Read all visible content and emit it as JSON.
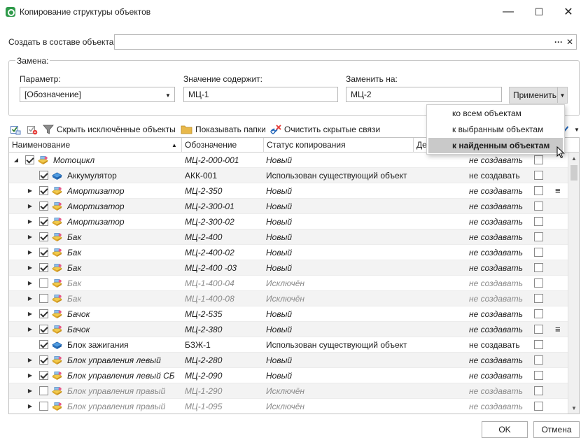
{
  "window": {
    "title": "Копирование структуры объектов",
    "minimize": "—",
    "maximize": "☐",
    "close": "✕"
  },
  "create": {
    "label": "Создать в составе объекта:",
    "value": "",
    "more": "···",
    "clear": "✕"
  },
  "replace": {
    "group_title": "Замена:",
    "param_label": "Параметр:",
    "param_value": "[Обозначение]",
    "contains_label": "Значение содержит:",
    "contains_value": "МЦ-1",
    "replace_label": "Заменить на:",
    "replace_value": "МЦ-2",
    "apply_label": "Применить"
  },
  "apply_menu": {
    "items": [
      {
        "label": "ко всем объектам"
      },
      {
        "label": "к выбранным объектам"
      },
      {
        "label": "к найденным объектам"
      }
    ],
    "highlighted_index": 2
  },
  "toolbar": {
    "hide_excluded": "Скрыть исключённые объекты",
    "show_folders": "Показывать папки",
    "clear_hidden_links": "Очистить скрытые связи"
  },
  "table": {
    "headers": {
      "name": "Наименование",
      "designation": "Обозначение",
      "status": "Статус копирования",
      "action": "Де"
    },
    "rows": [
      {
        "level": 0,
        "expand": "open",
        "checked": true,
        "italic": true,
        "grey": false,
        "icon": "assembly-icon",
        "name": "Мотоцикл",
        "designation": "МЦ-2-000-001",
        "status": "Новый",
        "action": "не создавать",
        "flag": false
      },
      {
        "level": 1,
        "expand": "none",
        "checked": true,
        "italic": false,
        "grey": false,
        "icon": "part-icon",
        "name": "Аккумулятор",
        "designation": "АКК-001",
        "status": "Использован существующий объект",
        "action": "не создавать",
        "flag": false
      },
      {
        "level": 1,
        "expand": "closed",
        "checked": true,
        "italic": true,
        "grey": false,
        "icon": "assembly-icon",
        "name": "Амортизатор",
        "designation": "МЦ-2-350",
        "status": "Новый",
        "action": "не создавать",
        "flag": true
      },
      {
        "level": 1,
        "expand": "closed",
        "checked": true,
        "italic": true,
        "grey": false,
        "icon": "assembly-icon",
        "name": "Амортизатор",
        "designation": "МЦ-2-300-01",
        "status": "Новый",
        "action": "не создавать",
        "flag": false
      },
      {
        "level": 1,
        "expand": "closed",
        "checked": true,
        "italic": true,
        "grey": false,
        "icon": "assembly-icon",
        "name": "Амортизатор",
        "designation": "МЦ-2-300-02",
        "status": "Новый",
        "action": "не создавать",
        "flag": false
      },
      {
        "level": 1,
        "expand": "closed",
        "checked": true,
        "italic": true,
        "grey": false,
        "icon": "assembly-icon",
        "name": "Бак",
        "designation": "МЦ-2-400",
        "status": "Новый",
        "action": "не создавать",
        "flag": false
      },
      {
        "level": 1,
        "expand": "closed",
        "checked": true,
        "italic": true,
        "grey": false,
        "icon": "assembly-icon",
        "name": "Бак",
        "designation": "МЦ-2-400-02",
        "status": "Новый",
        "action": "не создавать",
        "flag": false
      },
      {
        "level": 1,
        "expand": "closed",
        "checked": true,
        "italic": true,
        "grey": false,
        "icon": "assembly-icon",
        "name": "Бак",
        "designation": "МЦ-2-400 -03",
        "status": "Новый",
        "action": "не создавать",
        "flag": false
      },
      {
        "level": 1,
        "expand": "closed",
        "checked": false,
        "italic": true,
        "grey": true,
        "icon": "assembly-icon",
        "name": "Бак",
        "designation": "МЦ-1-400-04",
        "status": "Исключён",
        "action": "не создавать",
        "flag": false
      },
      {
        "level": 1,
        "expand": "closed",
        "checked": false,
        "italic": true,
        "grey": true,
        "icon": "assembly-icon",
        "name": "Бак",
        "designation": "МЦ-1-400-08",
        "status": "Исключён",
        "action": "не создавать",
        "flag": false
      },
      {
        "level": 1,
        "expand": "closed",
        "checked": true,
        "italic": true,
        "grey": false,
        "icon": "assembly-icon",
        "name": "Бачок",
        "designation": "МЦ-2-535",
        "status": "Новый",
        "action": "не создавать",
        "flag": false
      },
      {
        "level": 1,
        "expand": "closed",
        "checked": true,
        "italic": true,
        "grey": false,
        "icon": "assembly-icon",
        "name": "Бачок",
        "designation": "МЦ-2-380",
        "status": "Новый",
        "action": "не создавать",
        "flag": true
      },
      {
        "level": 1,
        "expand": "none",
        "checked": true,
        "italic": false,
        "grey": false,
        "icon": "part-icon",
        "name": "Блок зажигания",
        "designation": "БЗЖ-1",
        "status": "Использован существующий объект",
        "action": "не создавать",
        "flag": false
      },
      {
        "level": 1,
        "expand": "closed",
        "checked": true,
        "italic": true,
        "grey": false,
        "icon": "assembly-icon",
        "name": "Блок управления левый",
        "designation": "МЦ-2-280",
        "status": "Новый",
        "action": "не создавать",
        "flag": false
      },
      {
        "level": 1,
        "expand": "closed",
        "checked": true,
        "italic": true,
        "grey": false,
        "icon": "assembly-icon",
        "name": "Блок управления левый СБ",
        "designation": "МЦ-2-090",
        "status": "Новый",
        "action": "не создавать",
        "flag": false
      },
      {
        "level": 1,
        "expand": "closed",
        "checked": false,
        "italic": true,
        "grey": true,
        "icon": "assembly-icon",
        "name": "Блок управления правый",
        "designation": "МЦ-1-290",
        "status": "Исключён",
        "action": "не создавать",
        "flag": false
      },
      {
        "level": 1,
        "expand": "closed",
        "checked": false,
        "italic": true,
        "grey": true,
        "icon": "assembly-icon",
        "name": "Блок управления правый",
        "designation": "МЦ-1-095",
        "status": "Исключён",
        "action": "не создавать",
        "flag": false
      }
    ]
  },
  "buttons": {
    "ok": "OK",
    "cancel": "Отмена"
  }
}
